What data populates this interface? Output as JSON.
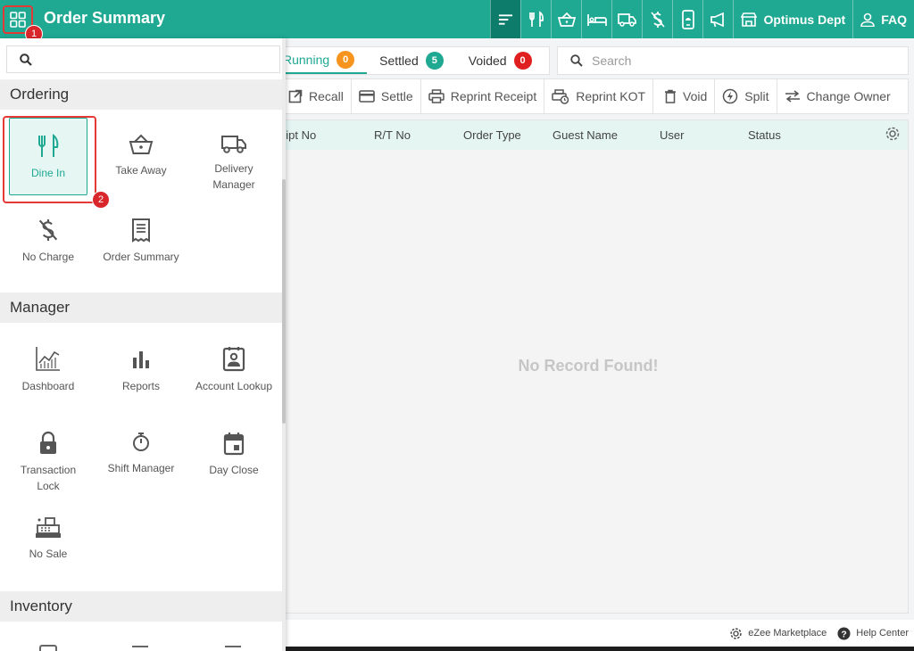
{
  "app": {
    "title": "Order Summary"
  },
  "markers": {
    "first": "1",
    "second": "2"
  },
  "topnav": {
    "department": "Optimus Dept",
    "faq": "FAQ"
  },
  "tabs": [
    {
      "label": "Running",
      "count": "0"
    },
    {
      "label": "Settled",
      "count": "5"
    },
    {
      "label": "Voided",
      "count": "0"
    }
  ],
  "search": {
    "placeholder": "Search"
  },
  "toolbar": {
    "recall": "Recall",
    "settle": "Settle",
    "reprint_receipt": "Reprint Receipt",
    "reprint_kot": "Reprint KOT",
    "void": "Void",
    "split": "Split",
    "change_owner": "Change Owner"
  },
  "table": {
    "columns": [
      "eipt No",
      "R/T No",
      "Order Type",
      "Guest Name",
      "User",
      "Status"
    ],
    "empty_message": "No Record Found!"
  },
  "footer": {
    "marketplace": "eZee Marketplace",
    "help": "Help Center"
  },
  "drawer": {
    "sections": {
      "ordering": "Ordering",
      "manager": "Manager",
      "inventory": "Inventory"
    },
    "ordering": {
      "dine_in": "Dine In",
      "take_away": "Take Away",
      "delivery_manager": "Delivery Manager",
      "no_charge": "No Charge",
      "order_summary": "Order Summary"
    },
    "manager": {
      "dashboard": "Dashboard",
      "reports": "Reports",
      "account_lookup": "Account Lookup",
      "transaction_lock": "Transaction Lock",
      "shift_manager": "Shift Manager",
      "day_close": "Day Close",
      "no_sale": "No Sale"
    }
  },
  "colors": {
    "brand": "#1fa892",
    "brand_dark": "#0e7c6b",
    "badge_orange": "#f7941d",
    "badge_red": "#e02020",
    "annotation_red": "#e53935"
  }
}
